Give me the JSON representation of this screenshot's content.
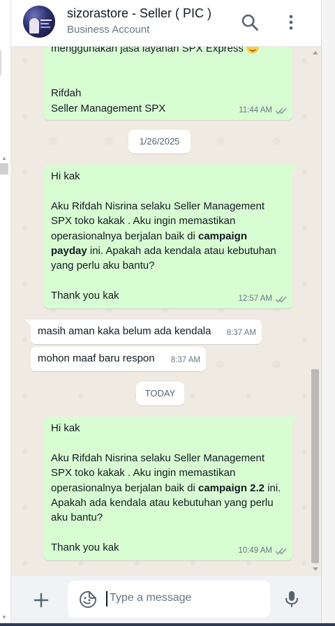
{
  "header": {
    "title": "sizorastore - Seller ( PIC )",
    "subtitle": "Business Account",
    "icons": [
      "search-icon",
      "menu-dots-icon"
    ]
  },
  "messages": [
    {
      "direction": "outgoing",
      "lines_top": "menggunakan jasa layanan SPX Express",
      "emoji": "smiling-face-icon",
      "lines_bottom": "Rifdah\nSeller Management SPX",
      "time": "11:44 AM",
      "status": "read"
    },
    {
      "direction": "outgoing",
      "part1": "Hi kak\n\nAku Rifdah Nisrina selaku Seller Management SPX toko kakak . Aku ingin memastikan operasionalnya berjalan baik di ",
      "bold": "campaign payday",
      "part2": " ini. Apakah ada kendala atau kebutuhan yang perlu aku bantu?\n\nThank you kak",
      "time": "12:57 AM",
      "status": "read"
    },
    {
      "direction": "incoming",
      "text": "masih aman kaka belum ada kendala",
      "time": "8:37 AM"
    },
    {
      "direction": "incoming",
      "text": "mohon maaf baru respon",
      "time": "8:37 AM"
    },
    {
      "direction": "outgoing",
      "part1": "Hi kak\n\nAku Rifdah Nisrina selaku Seller Management SPX toko kakak . Aku ingin memastikan operasionalnya berjalan baik di ",
      "bold": "campaign 2.2",
      "part2": " ini. Apakah ada kendala atau kebutuhan yang perlu aku bantu?\n\nThank you kak",
      "time": "10:49 AM",
      "status": "read"
    }
  ],
  "date_separators": [
    "1/26/2025",
    "TODAY"
  ],
  "composer": {
    "placeholder": "Type a message",
    "icons": [
      "plus-icon",
      "sticker-icon",
      "microphone-icon"
    ]
  },
  "colors": {
    "outgoing_bubble": "#d9fdd3",
    "incoming_bubble": "#ffffff",
    "chat_background": "#efeae2",
    "read_ticks": "#667781"
  }
}
